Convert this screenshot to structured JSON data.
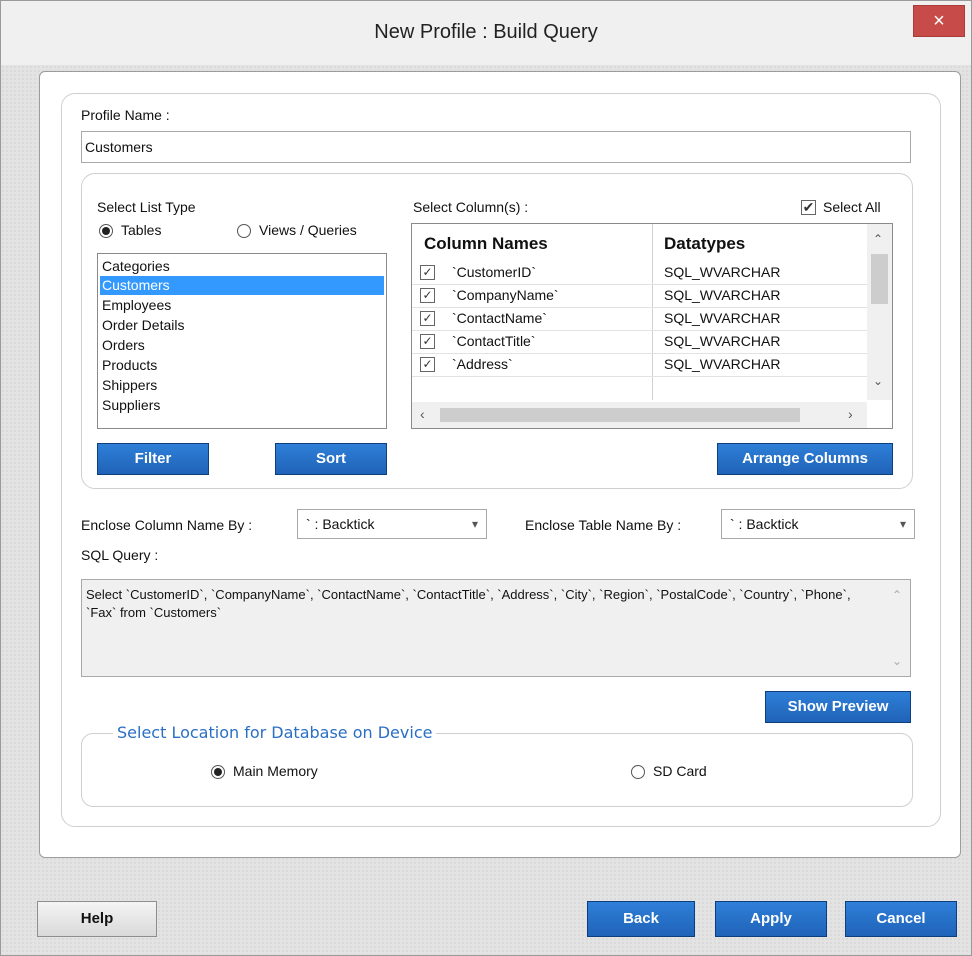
{
  "window": {
    "title": "New Profile : Build Query",
    "close_glyph": "×"
  },
  "profile": {
    "label": "Profile Name :",
    "value": "Customers"
  },
  "list_type": {
    "label": "Select List Type",
    "options": [
      {
        "label": "Tables",
        "checked": true
      },
      {
        "label": "Views / Queries",
        "checked": false
      }
    ],
    "items": [
      "Categories",
      "Customers",
      "Employees",
      "Order Details",
      "Orders",
      "Products",
      "Shippers",
      "Suppliers"
    ],
    "selected_index": 1
  },
  "buttons": {
    "filter": "Filter",
    "sort": "Sort",
    "arrange": "Arrange Columns",
    "show_preview": "Show Preview",
    "help": "Help",
    "back": "Back",
    "apply": "Apply",
    "cancel": "Cancel"
  },
  "columns": {
    "label": "Select Column(s) :",
    "select_all_label": "Select All",
    "select_all_checked": true,
    "headers": [
      "Column Names",
      "Datatypes"
    ],
    "rows": [
      {
        "name": "`CustomerID`",
        "type": "SQL_WVARCHAR"
      },
      {
        "name": "`CompanyName`",
        "type": "SQL_WVARCHAR"
      },
      {
        "name": "`ContactName`",
        "type": "SQL_WVARCHAR"
      },
      {
        "name": "`ContactTitle`",
        "type": "SQL_WVARCHAR"
      },
      {
        "name": "`Address`",
        "type": "SQL_WVARCHAR"
      }
    ]
  },
  "enclose": {
    "column_label": "Enclose Column Name By :",
    "column_value": "` : Backtick",
    "table_label": "Enclose Table Name By :",
    "table_value": "` : Backtick"
  },
  "sql": {
    "label": "SQL Query :",
    "text": "Select `CustomerID`, `CompanyName`, `ContactName`, `ContactTitle`, `Address`, `City`, `Region`, `PostalCode`, `Country`, `Phone`, `Fax` from `Customers`"
  },
  "location": {
    "legend": "Select Location for Database on Device",
    "options": [
      {
        "label": "Main Memory",
        "checked": true
      },
      {
        "label": "SD Card",
        "checked": false
      }
    ]
  }
}
